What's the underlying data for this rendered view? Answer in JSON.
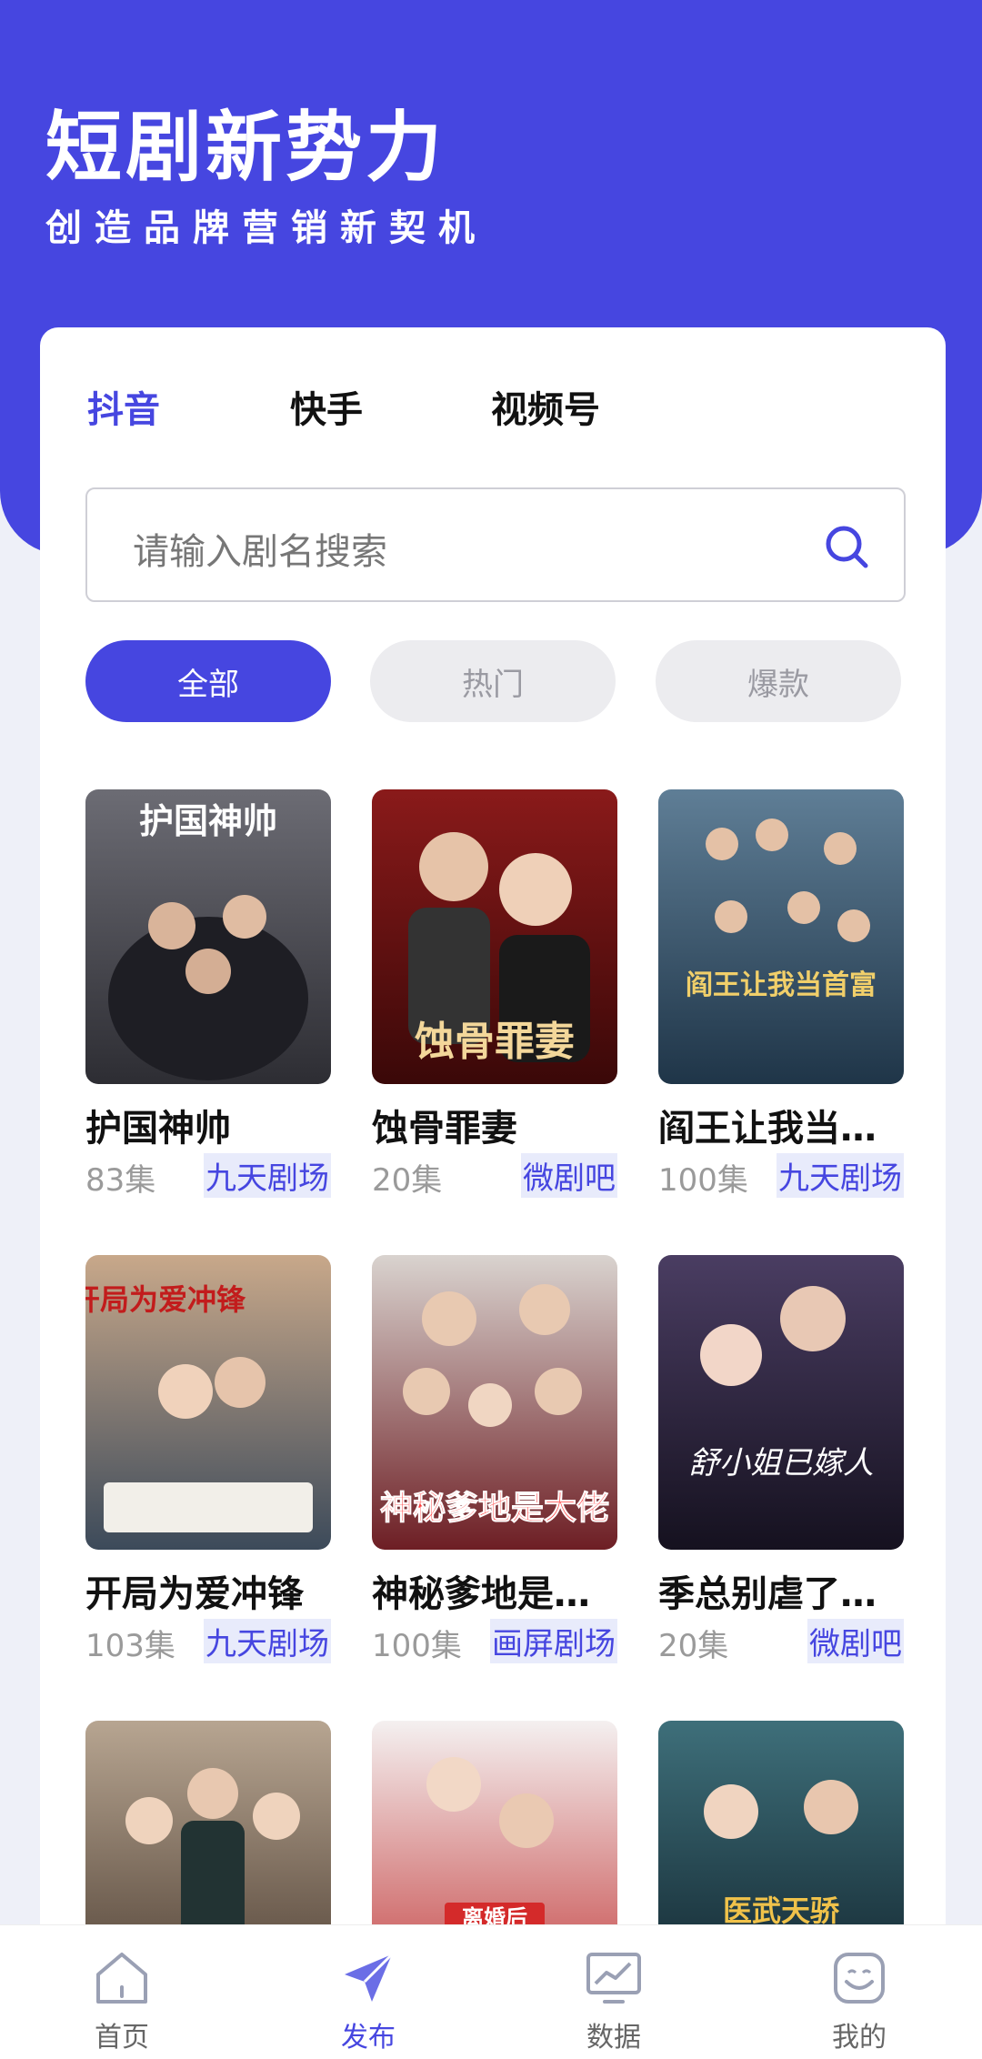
{
  "header": {
    "title": "短剧新势力",
    "subtitle": "创造品牌营销新契机"
  },
  "tabs": [
    "抖音",
    "快手",
    "视频号"
  ],
  "active_tab": 0,
  "search": {
    "placeholder": "请输入剧名搜索",
    "icon": "search-icon"
  },
  "filters": [
    "全部",
    "热门",
    "爆款"
  ],
  "active_filter": 0,
  "colors": {
    "primary": "#4646e0",
    "tag_bg": "#e8ebfb"
  },
  "dramas": [
    {
      "title": "护国神帅",
      "count": "83集",
      "tag": "九天剧场",
      "poster_text": "护国神帅"
    },
    {
      "title": "蚀骨罪妻",
      "count": "20集",
      "tag": "微剧吧",
      "poster_text": "蚀骨罪妻"
    },
    {
      "title": "阎王让我当…",
      "count": "100集",
      "tag": "九天剧场",
      "poster_text": "阎王让我当首富"
    },
    {
      "title": "开局为爱冲锋",
      "count": "103集",
      "tag": "九天剧场",
      "poster_text": "开局为爱冲锋"
    },
    {
      "title": "神秘爹地是…",
      "count": "100集",
      "tag": "画屏剧场",
      "poster_text": "神秘爹地是大佬"
    },
    {
      "title": "季总别虐了…",
      "count": "20集",
      "tag": "微剧吧",
      "poster_text": "舒小姐已嫁人"
    },
    {
      "title": "",
      "count": "",
      "tag": "",
      "poster_text": ""
    },
    {
      "title": "",
      "count": "",
      "tag": "",
      "poster_text": "离婚后"
    },
    {
      "title": "",
      "count": "",
      "tag": "",
      "poster_text": "医武天骄"
    }
  ],
  "bottom_nav": [
    {
      "label": "首页",
      "icon": "home-icon"
    },
    {
      "label": "发布",
      "icon": "send-icon"
    },
    {
      "label": "数据",
      "icon": "chart-icon"
    },
    {
      "label": "我的",
      "icon": "profile-icon"
    }
  ],
  "active_nav": 1
}
